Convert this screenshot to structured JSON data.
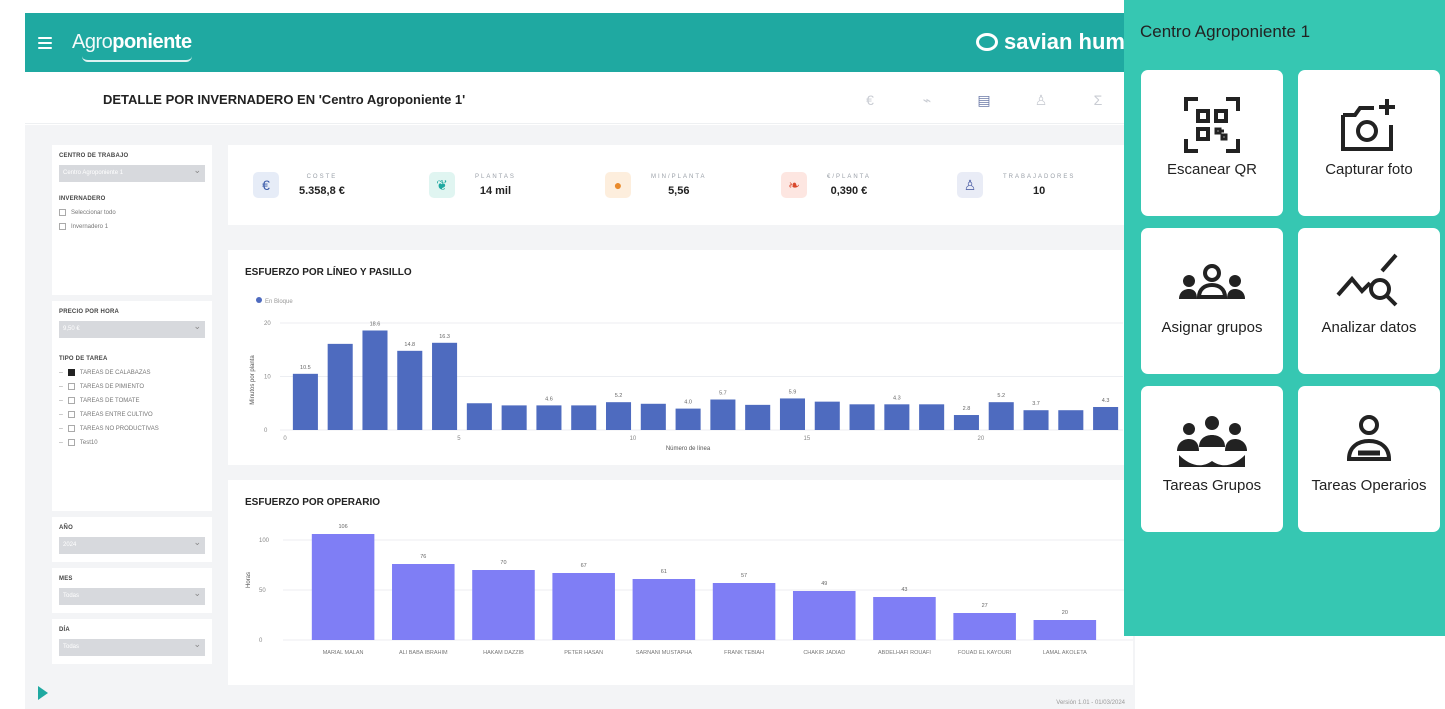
{
  "header": {
    "brand_light": "Agro",
    "brand_bold": "poniente",
    "partner": "savian hum",
    "title": "DETALLE POR INVERNADERO EN 'Centro Agroponiente 1'",
    "icons": [
      "euro-icon",
      "chart-icon",
      "report-icon",
      "worker-icon",
      "sum-icon"
    ]
  },
  "filters": {
    "centro_label": "CENTRO DE TRABAJO",
    "centro_value": "Centro Agroponiente 1",
    "invernadero_label": "INVERNADERO",
    "invernadero_options": [
      "Seleccionar todo",
      "Invernadero 1"
    ],
    "precio_label": "PRECIO POR HORA",
    "precio_value": "9,50 €",
    "tipo_label": "TIPO DE TAREA",
    "tipo_options": [
      {
        "label": "TAREAS DE CALABAZAS",
        "checked": true
      },
      {
        "label": "TAREAS DE PIMIENTO",
        "checked": false
      },
      {
        "label": "TAREAS DE TOMATE",
        "checked": false
      },
      {
        "label": "TAREAS ENTRE CULTIVO",
        "checked": false
      },
      {
        "label": "TAREAS NO PRODUCTIVAS",
        "checked": false
      },
      {
        "label": "Test10",
        "checked": false
      }
    ],
    "ano_label": "AÑO",
    "ano_value": "2024",
    "mes_label": "MES",
    "mes_value": "Todas",
    "dia_label": "DÍA",
    "dia_value": "Todas"
  },
  "kpis": [
    {
      "label": "COSTE",
      "value": "5.358,8 €",
      "icon": "euro-icon",
      "bg": "#e6ecf7",
      "fg": "#3b5ba9"
    },
    {
      "label": "PLANTAS",
      "value": "14 mil",
      "icon": "plant-icon",
      "bg": "#e0f5f1",
      "fg": "#1fa9a1"
    },
    {
      "label": "MIN/PLANTA",
      "value": "5,56",
      "icon": "clock-icon",
      "bg": "#fdeedd",
      "fg": "#e98a2c"
    },
    {
      "label": "€/PLANTA",
      "value": "0,390 €",
      "icon": "leaf-icon",
      "bg": "#fde6e1",
      "fg": "#d9472b"
    },
    {
      "label": "TRABAJADORES",
      "value": "10",
      "icon": "worker-icon",
      "bg": "#e9ecf6",
      "fg": "#5566aa"
    }
  ],
  "chart1_title": "ESFUERZO POR LÍNEO Y PASILLO",
  "chart2_title": "ESFUERZO POR OPERARIO",
  "chart_data": [
    {
      "type": "bar",
      "title": "ESFUERZO POR LÍNEO Y PASILLO",
      "legend": "En Bloque",
      "xlabel": "Número de línea",
      "ylabel": "Minutos por planta",
      "ylim": [
        0,
        20
      ],
      "yticks": [
        0,
        10,
        20
      ],
      "xticks": [
        {
          "i": 0,
          "label": "0"
        },
        {
          "i": 5,
          "label": "5"
        },
        {
          "i": 10,
          "label": "10"
        },
        {
          "i": 15,
          "label": "15"
        },
        {
          "i": 20,
          "label": "20"
        }
      ],
      "color": "#4e6bbf",
      "values": [
        10.5,
        16.1,
        18.6,
        14.8,
        16.3,
        5.0,
        4.6,
        4.6,
        4.6,
        5.2,
        4.9,
        4.0,
        5.7,
        4.7,
        5.9,
        5.3,
        4.8,
        4.8,
        4.8,
        2.8,
        5.2,
        3.7,
        3.7,
        4.3
      ],
      "labels": [
        "10.5",
        "",
        "18.6",
        "14.8",
        "16.3",
        "",
        "",
        "4.6",
        "",
        "5.2",
        "",
        "4.0",
        "5.7",
        "",
        "5.9",
        "",
        "",
        "4.3",
        "",
        "2.8",
        "5.2",
        "3.7",
        "",
        "4.3"
      ]
    },
    {
      "type": "bar",
      "title": "ESFUERZO POR OPERARIO",
      "ylabel": "Horas",
      "ylim": [
        0,
        110
      ],
      "yticks": [
        0,
        50,
        100
      ],
      "color": "#7f7ef5",
      "categories": [
        "MARIAL MALAN",
        "ALI BABA IBRAHIM",
        "HAKAM DAZZIB",
        "PETER HASAN",
        "SARNANI MUSTAPHA",
        "FRANK TEBIAH",
        "CHAKIR JADIAD",
        "ABDELHAFI ROUAFI",
        "FOUAD EL KAYOURI",
        "LAMAL AKOLETA"
      ],
      "values": [
        106,
        76,
        70,
        67,
        61,
        57,
        49,
        43,
        27,
        20
      ]
    }
  ],
  "version": "Versión 1.01 - 01/03/2024",
  "panel": {
    "title": "Centro Agroponiente 1",
    "tiles": [
      {
        "label": "Escanear QR",
        "icon": "qr-scan-icon"
      },
      {
        "label": "Capturar foto",
        "icon": "camera-add-icon"
      },
      {
        "label": "Asignar grupos",
        "icon": "group-assign-icon"
      },
      {
        "label": "Analizar datos",
        "icon": "analytics-search-icon"
      },
      {
        "label": "Tareas Grupos",
        "icon": "group-tasks-icon"
      },
      {
        "label": "Tareas Operarios",
        "icon": "operator-tasks-icon"
      }
    ]
  }
}
